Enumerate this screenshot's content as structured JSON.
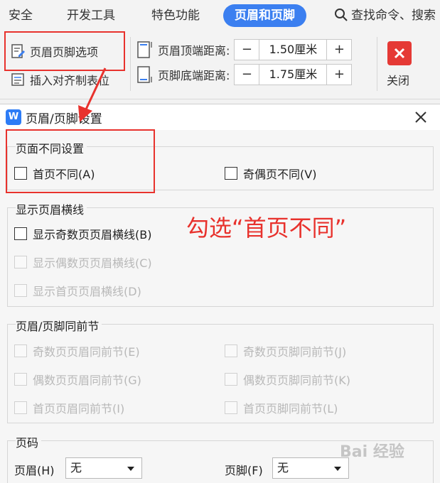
{
  "ribbon": {
    "tabs": [
      {
        "label": "安全"
      },
      {
        "label": "开发工具"
      },
      {
        "label": "特色功能"
      },
      {
        "label": "页眉和页脚",
        "active": true
      }
    ],
    "search_label": "查找命令、搜索",
    "header_footer_options_label": "页眉页脚选项",
    "insert_align_tab_label": "插入对齐制表位",
    "header_top_distance": {
      "label": "页眉顶端距离:",
      "value": "1.50厘米"
    },
    "footer_bottom_distance": {
      "label": "页脚底端距离:",
      "value": "1.75厘米"
    },
    "minus": "−",
    "plus": "+",
    "close_label": "关闭",
    "accent_color": "#3b7ff0",
    "close_color": "#e53935"
  },
  "dialog": {
    "title": "页眉/页脚设置",
    "logo_letter": "W",
    "diff_settings": {
      "title": "页面不同设置",
      "first_page_diff": "首页不同(A)",
      "odd_even_diff": "奇偶页不同(V)"
    },
    "header_lines": {
      "title": "显示页眉横线",
      "odd": "显示奇数页页眉横线(B)",
      "even": "显示偶数页页眉横线(C)",
      "first": "显示首页页眉横线(D)"
    },
    "same_as_prev": {
      "title": "页眉/页脚同前节",
      "odd_header": "奇数页页眉同前节(E)",
      "odd_footer": "奇数页页脚同前节(J)",
      "even_header": "偶数页页眉同前节(G)",
      "even_footer": "偶数页页脚同前节(K)",
      "first_header": "首页页眉同前节(I)",
      "first_footer": "首页页脚同前节(L)"
    },
    "page_number": {
      "title": "页码",
      "header_label": "页眉(H)",
      "header_value": "无",
      "footer_label": "页脚(F)",
      "footer_value": "无"
    }
  },
  "annotation": {
    "text": "勾选“首页不同”",
    "color": "#e8322d"
  },
  "watermark": "Bai 经验"
}
